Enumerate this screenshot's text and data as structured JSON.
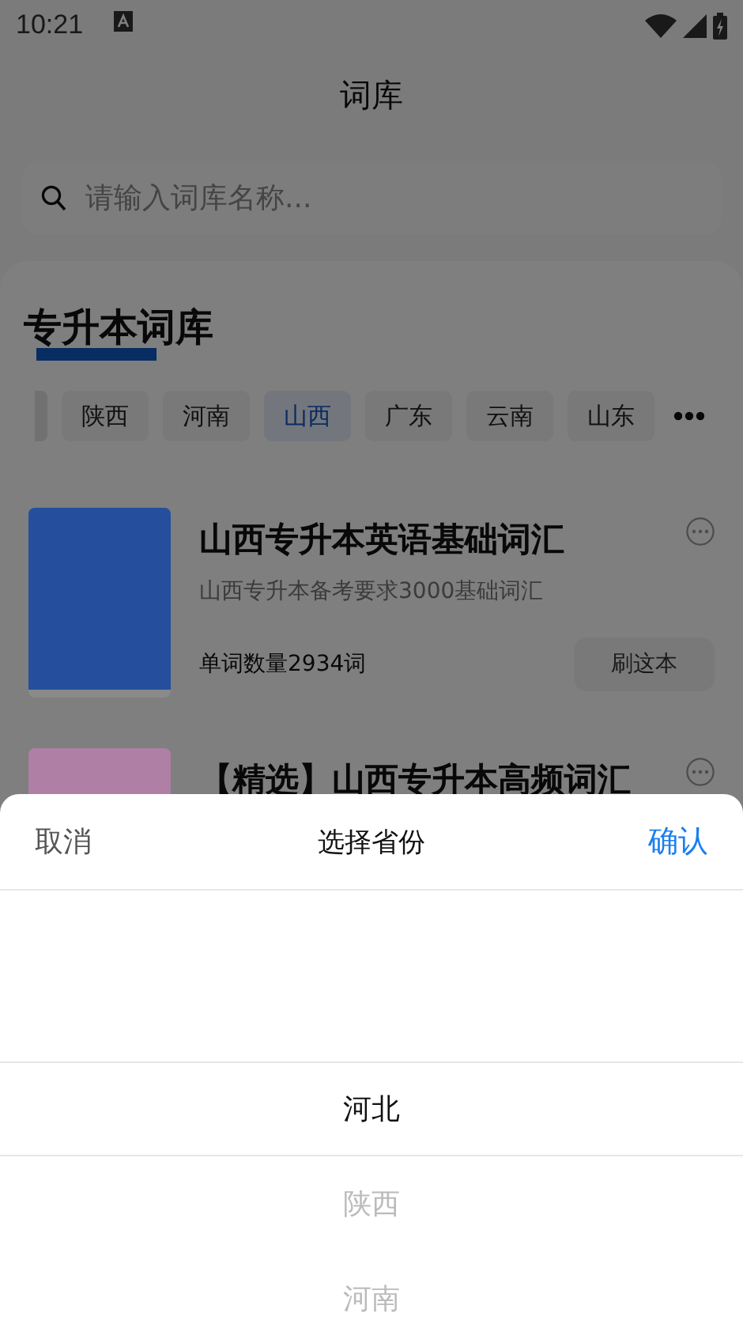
{
  "status_bar": {
    "time": "10:21"
  },
  "header": {
    "title": "词库"
  },
  "search": {
    "placeholder": "请输入词库名称..."
  },
  "section": {
    "title": "专升本词库"
  },
  "tabs": [
    {
      "label": "陕西",
      "selected": false
    },
    {
      "label": "河南",
      "selected": false
    },
    {
      "label": "山西",
      "selected": true
    },
    {
      "label": "广东",
      "selected": false
    },
    {
      "label": "云南",
      "selected": false
    },
    {
      "label": "山东",
      "selected": false
    }
  ],
  "books": [
    {
      "title": "山西专升本英语基础词汇",
      "description": "山西专升本备考要求3000基础词汇",
      "count": "单词数量2934词",
      "action": "刷这本",
      "color": "#254f9c"
    },
    {
      "title": "【精选】山西专升本高频词汇",
      "color": "#b07fa5"
    }
  ],
  "picker": {
    "cancel": "取消",
    "title": "选择省份",
    "confirm": "确认",
    "options": [
      {
        "label": "河北",
        "selected": true
      },
      {
        "label": "陕西",
        "selected": false
      },
      {
        "label": "河南",
        "selected": false
      }
    ]
  }
}
